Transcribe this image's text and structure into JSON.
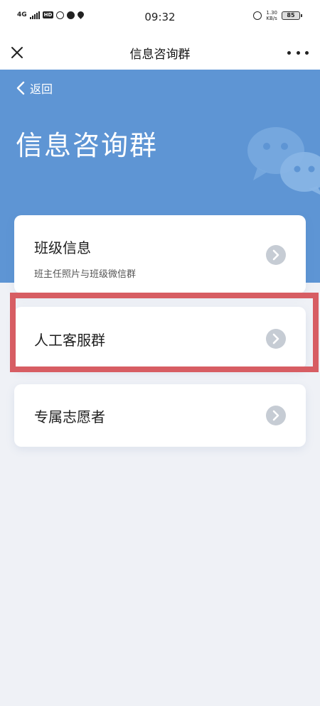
{
  "status_bar": {
    "network": "4G",
    "hd": "HD",
    "time": "09:32",
    "net_speed_value": "1.30",
    "net_speed_unit": "KB/s",
    "battery": "85"
  },
  "nav": {
    "title": "信息咨询群",
    "close_icon": "close-icon",
    "more_icon": "more-icon"
  },
  "hero": {
    "back_label": "返回",
    "title": "信息咨询群",
    "background_color": "#5e95d4",
    "decor_icon": "wechat-icon"
  },
  "cards": [
    {
      "title": "班级信息",
      "subtitle": "班主任照片与班级微信群"
    },
    {
      "title": "人工客服群",
      "subtitle": ""
    },
    {
      "title": "专属志愿者",
      "subtitle": ""
    }
  ],
  "highlight_color": "#d75d63"
}
